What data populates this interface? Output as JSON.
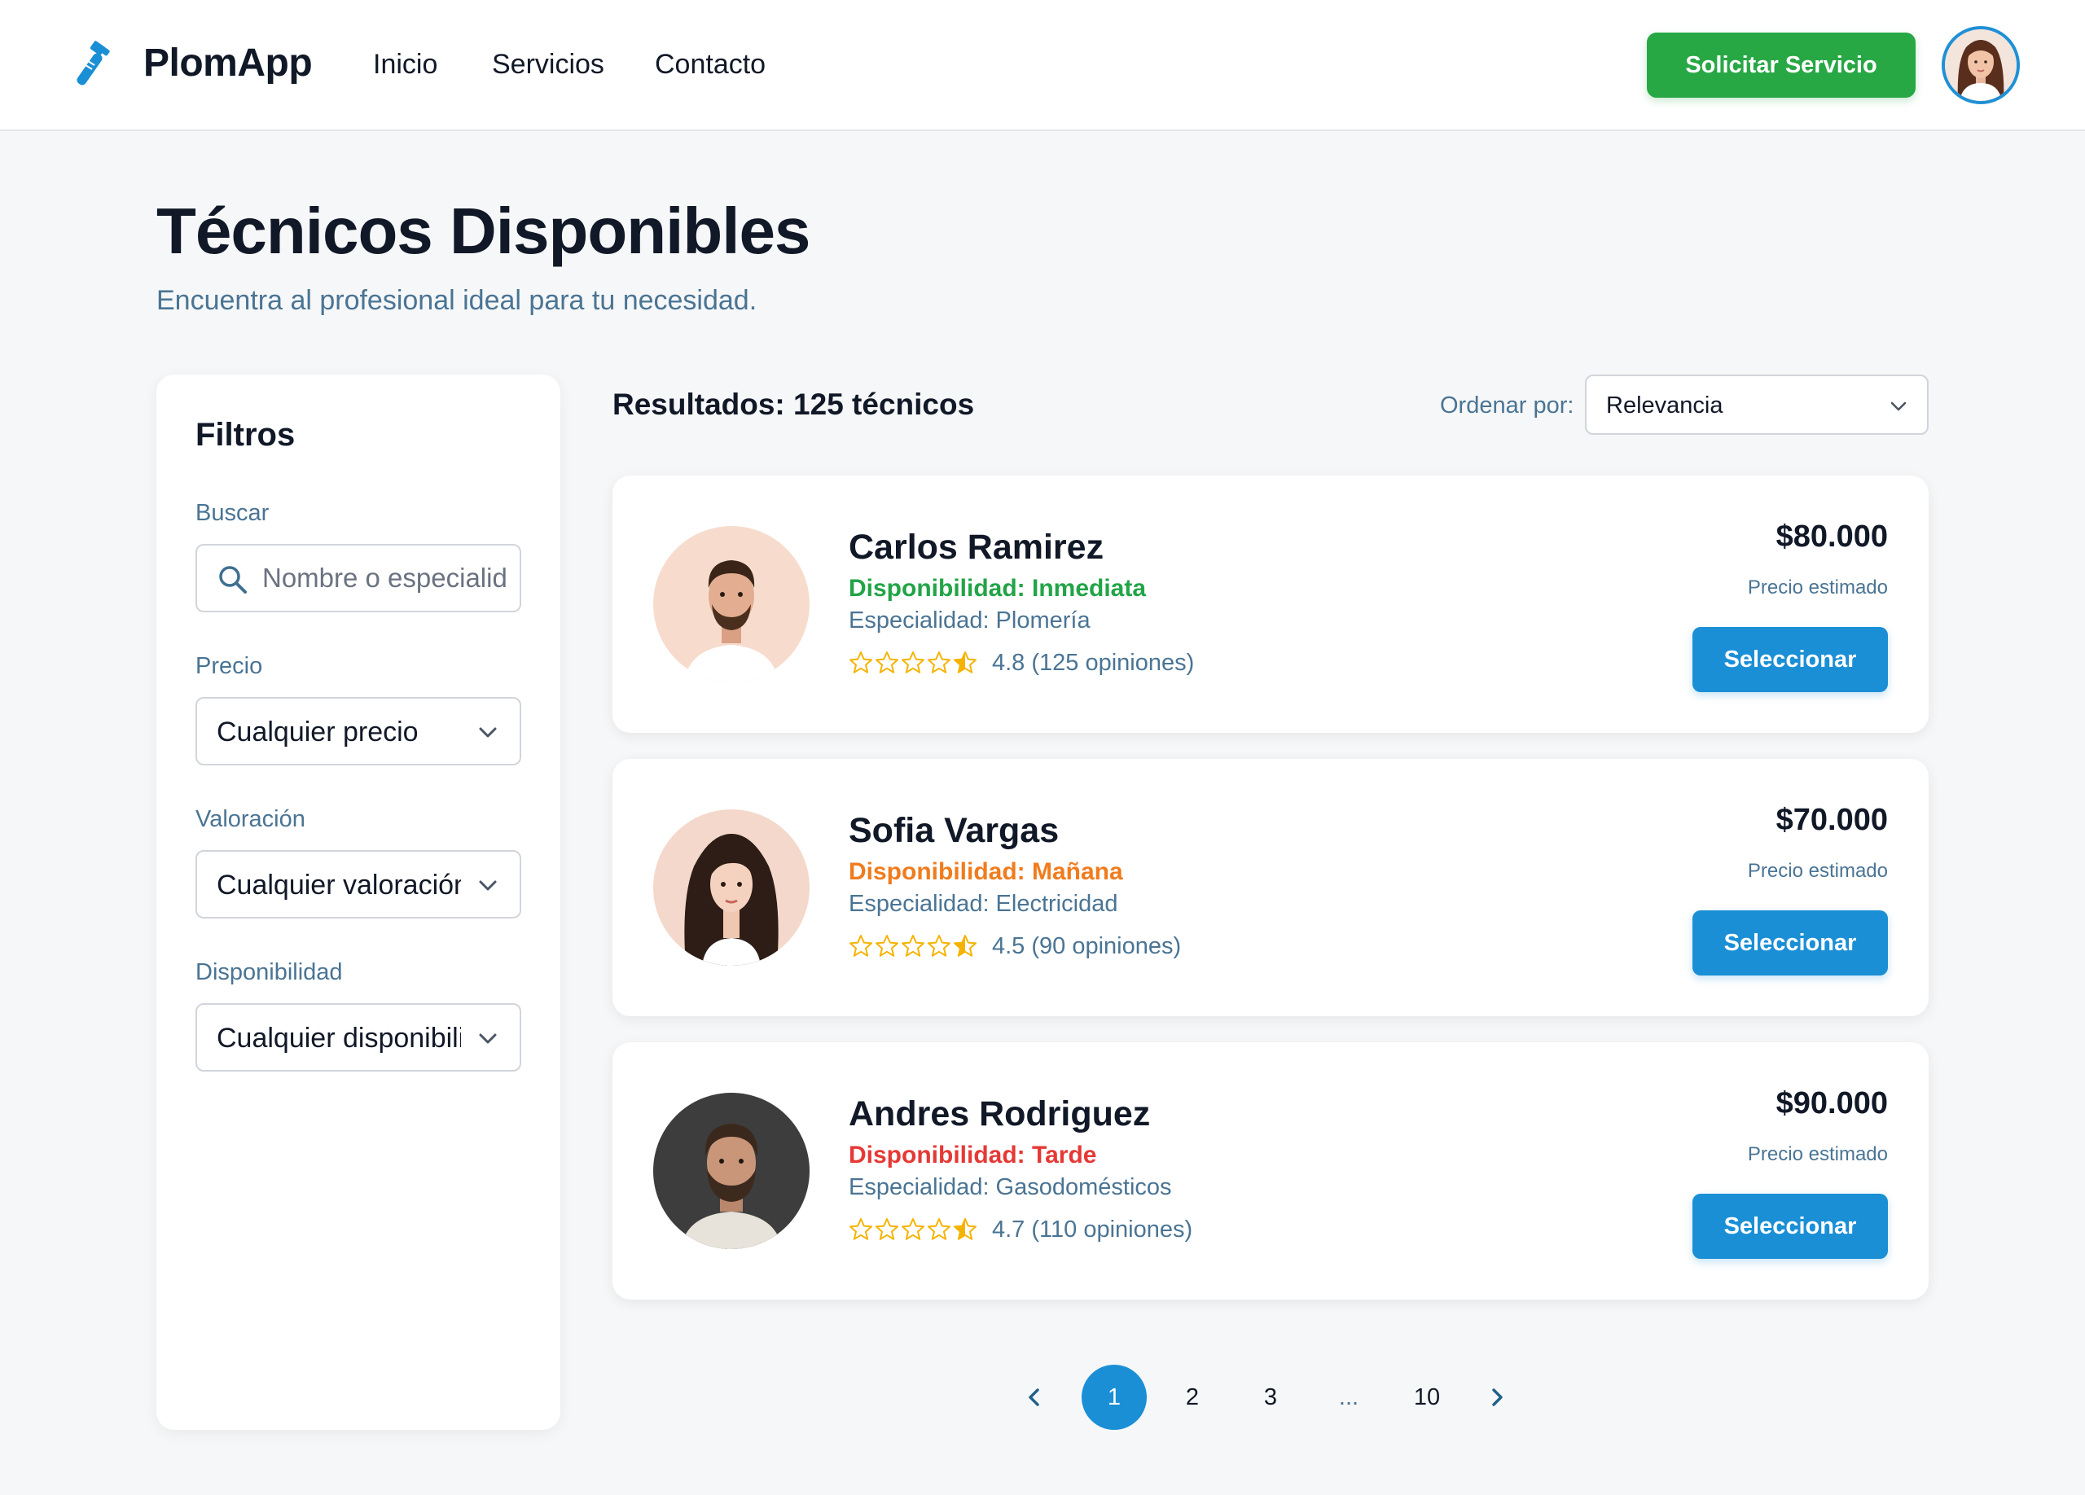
{
  "header": {
    "app_name": "PlomApp",
    "nav": [
      "Inicio",
      "Servicios",
      "Contacto"
    ],
    "cta_label": "Solicitar Servicio"
  },
  "page": {
    "title": "Técnicos Disponibles",
    "subtitle": "Encuentra al profesional ideal para tu necesidad."
  },
  "filters": {
    "title": "Filtros",
    "search": {
      "label": "Buscar",
      "placeholder": "Nombre o especialidad",
      "value": ""
    },
    "price": {
      "label": "Precio",
      "selected": "Cualquier precio"
    },
    "rating": {
      "label": "Valoración",
      "selected": "Cualquier valoración"
    },
    "availability": {
      "label": "Disponibilidad",
      "selected": "Cualquier disponibilidad"
    }
  },
  "results": {
    "title": "Resultados: 125 técnicos",
    "sort_label": "Ordenar por:",
    "sort_selected": "Relevancia"
  },
  "technicians": [
    {
      "name": "Carlos Ramirez",
      "availability": "Disponibilidad: Inmediata",
      "availability_color": "#22a447",
      "specialty": "Especialidad: Plomería",
      "rating_value": 4.8,
      "rating_text": "4.8 (125 opiniones)",
      "price": "$80.000",
      "price_note": "Precio estimado",
      "button_label": "Seleccionar"
    },
    {
      "name": "Sofia Vargas",
      "availability": "Disponibilidad: Mañana",
      "availability_color": "#f07c1e",
      "specialty": "Especialidad: Electricidad",
      "rating_value": 4.5,
      "rating_text": "4.5 (90 opiniones)",
      "price": "$70.000",
      "price_note": "Precio estimado",
      "button_label": "Seleccionar"
    },
    {
      "name": "Andres Rodriguez",
      "availability": "Disponibilidad: Tarde",
      "availability_color": "#e53935",
      "specialty": "Especialidad: Gasodomésticos",
      "rating_value": 4.7,
      "rating_text": "4.7 (110 opiniones)",
      "price": "$90.000",
      "price_note": "Precio estimado",
      "button_label": "Seleccionar"
    }
  ],
  "pagination": {
    "pages": [
      "1",
      "2",
      "3",
      "...",
      "10"
    ],
    "current": "1",
    "prev_icon": "chevron-left-icon",
    "next_icon": "chevron-right-icon"
  },
  "colors": {
    "accent": "#1a8fd6",
    "cta": "#28a745",
    "star": "#f5b301"
  }
}
